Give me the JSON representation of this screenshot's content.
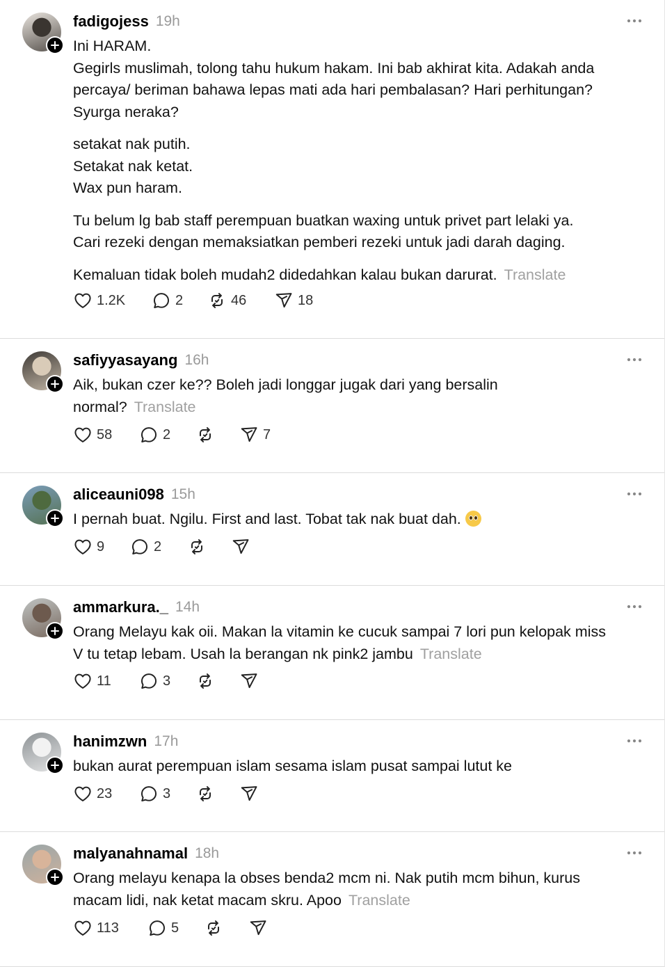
{
  "posts": [
    {
      "username": "fadigojess",
      "time": "19h",
      "paragraphs": [
        [
          "Ini HARAM.",
          "Gegirls muslimah, tolong tahu hukum hakam. Ini bab akhirat kita. Adakah anda",
          "percaya/ beriman bahawa lepas mati ada hari pembalasan? Hari perhitungan?",
          "Syurga neraka?"
        ],
        [
          "setakat nak putih.",
          "Setakat nak ketat.",
          "Wax pun haram."
        ],
        [
          "Tu belum lg bab staff perempuan buatkan waxing untuk privet part lelaki ya.",
          "Cari rezeki dengan memaksiatkan pemberi rezeki untuk jadi darah daging."
        ],
        [
          "Kemaluan tidak boleh mudah2 didedahkan kalau bukan darurat."
        ]
      ],
      "translate": "Translate",
      "likes": "1.2K",
      "replies": "2",
      "reposts": "46",
      "shares": "18",
      "avatar_colors": [
        "#e9e4de",
        "#3a3530"
      ]
    },
    {
      "username": "safiyyasayang",
      "time": "16h",
      "paragraphs": [
        [
          "Aik, bukan czer ke?? Boleh jadi longgar jugak dari yang bersalin",
          "normal?"
        ]
      ],
      "translate": "Translate",
      "likes": "58",
      "replies": "2",
      "reposts": "",
      "shares": "7",
      "avatar_colors": [
        "#3f3b37",
        "#d9cbb8"
      ]
    },
    {
      "username": "aliceauni098",
      "time": "15h",
      "paragraphs": [
        [
          "I pernah buat. Ngilu. First and last. Tobat tak nak buat dah."
        ]
      ],
      "translate": "",
      "emoji": "pleading-face-emoji",
      "likes": "9",
      "replies": "2",
      "reposts": "",
      "shares": "",
      "avatar_colors": [
        "#7a9cb8",
        "#4e6a3f"
      ]
    },
    {
      "username": "ammarkura._",
      "time": "14h",
      "paragraphs": [
        [
          "Orang Melayu kak oii. Makan la vitamin ke cucuk sampai 7 lori pun kelopak miss",
          "V tu tetap lebam. Usah la berangan nk pink2 jambu"
        ]
      ],
      "translate": "Translate",
      "likes": "11",
      "replies": "3",
      "reposts": "",
      "shares": "",
      "avatar_colors": [
        "#bfc3c2",
        "#6d5a4e"
      ]
    },
    {
      "username": "hanimzwn",
      "time": "17h",
      "paragraphs": [
        [
          "bukan aurat perempuan islam sesama islam pusat sampai lutut ke"
        ]
      ],
      "translate": "",
      "likes": "23",
      "replies": "3",
      "reposts": "",
      "shares": "",
      "avatar_colors": [
        "#8e9396",
        "#f2f2f2"
      ]
    },
    {
      "username": "malyanahnamal",
      "time": "18h",
      "paragraphs": [
        [
          "Orang melayu kenapa la obses benda2 mcm ni. Nak putih mcm bihun, kurus",
          "macam lidi, nak ketat macam skru. Apoo"
        ]
      ],
      "translate": "Translate",
      "likes": "113",
      "replies": "5",
      "reposts": "",
      "shares": "",
      "avatar_colors": [
        "#9aa6a8",
        "#d8b49a"
      ]
    }
  ],
  "icons": {
    "like": "heart-icon",
    "reply": "comment-icon",
    "repost": "repost-icon",
    "share": "send-icon",
    "more": "more-dots-icon",
    "follow": "plus-icon"
  }
}
